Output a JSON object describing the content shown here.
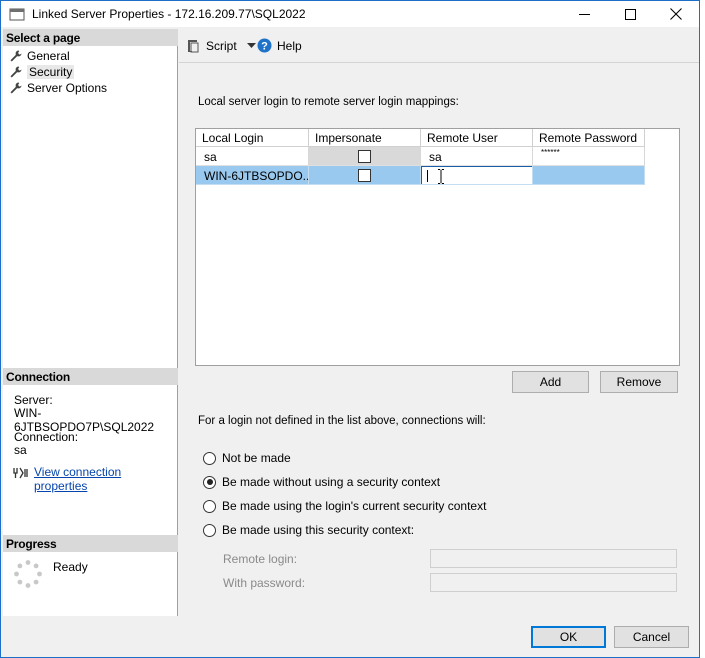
{
  "window": {
    "title": "Linked Server Properties - 172.16.209.77\\SQL2022"
  },
  "sidebar": {
    "select_page_title": "Select a page",
    "pages": [
      {
        "label": "General"
      },
      {
        "label": "Security"
      },
      {
        "label": "Server Options"
      }
    ],
    "connection": {
      "title": "Connection",
      "server_label": "Server:",
      "server_value": "WIN-6JTBSOPDO7P\\SQL2022",
      "connection_label": "Connection:",
      "connection_value": "sa",
      "view_link": "View connection properties"
    },
    "progress": {
      "title": "Progress",
      "status": "Ready"
    }
  },
  "toolbar": {
    "script_label": "Script",
    "help_label": "Help"
  },
  "mappings": {
    "intro": "Local server login to remote server login mappings:",
    "columns": [
      "Local Login",
      "Impersonate",
      "Remote User",
      "Remote Password"
    ],
    "rows": [
      {
        "local_login": "sa",
        "impersonate": false,
        "remote_user": "sa",
        "remote_password": "******"
      },
      {
        "local_login": "WIN-6JTBSOPDO...",
        "impersonate": false,
        "remote_user": "",
        "remote_password": ""
      }
    ],
    "add_label": "Add",
    "remove_label": "Remove"
  },
  "fallback": {
    "text": "For a login not defined in the list above, connections will:",
    "options": [
      {
        "label": "Not be made",
        "checked": false
      },
      {
        "label": "Be made without using a security context",
        "checked": true
      },
      {
        "label": "Be made using the login's current security context",
        "checked": false
      },
      {
        "label": "Be made using this security context:",
        "checked": false
      }
    ],
    "remote_login_label": "Remote login:",
    "with_password_label": "With password:"
  },
  "footer": {
    "ok_label": "OK",
    "cancel_label": "Cancel"
  },
  "colors": {
    "selected_row": "#99c9ef",
    "window_border": "#1e6fc8",
    "link": "#0645ad"
  }
}
